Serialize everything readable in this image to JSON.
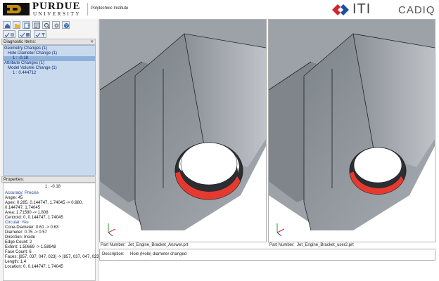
{
  "header": {
    "university": "PURDUE",
    "university_sub": "UNIVERSITY",
    "department": "Polytechnic Institute",
    "vendor": "ITI",
    "product": "CADIQ",
    "colors": {
      "purdue_gold": "#c28e0e",
      "iti_red": "#d3242e",
      "iti_blue": "#1f4e9c"
    }
  },
  "toolbar": {
    "icons": [
      "home-icon",
      "open-file-icon",
      "export-icon",
      "report-icon",
      "search-icon",
      "settings-icon",
      "help-icon",
      "check-geometry-icon",
      "check-all-icon",
      "check-filter-icon"
    ]
  },
  "diagnostics": {
    "title": "Diagnostic Items:",
    "items": [
      {
        "label": "Geometry Changes (1)",
        "level": 0
      },
      {
        "label": "Hole Diameter Change (1)",
        "level": 1
      },
      {
        "label": "1 : -0.18",
        "level": 2,
        "selected": true
      },
      {
        "label": "Attribute Changes (1)",
        "level": 0
      },
      {
        "label": "Model Volume Change (1)",
        "level": 1
      },
      {
        "label": "1 : 0.444712",
        "level": 2
      }
    ]
  },
  "properties": {
    "title": "Properties:",
    "header_value": "1 : -0.18",
    "rows": [
      {
        "text": "Accuracy: Precise",
        "blue": true
      },
      {
        "text": "Angle: 45",
        "blue": false
      },
      {
        "text": "Apex: 0.285, 0.144747, 1.74045 -> 0.980,",
        "blue": false
      },
      {
        "text": "0.144747, 1.74045",
        "blue": false
      },
      {
        "text": "Area: 1.71580 -> 1.808",
        "blue": false
      },
      {
        "text": "Centroid: 0, 0.144747, 1.74045",
        "blue": false
      },
      {
        "text": "Circular: Yes",
        "blue": true
      },
      {
        "text": "Cone-Diameter: 0.61 -> 0.63",
        "blue": false
      },
      {
        "text": "Diameter: 0.75 -> 0.57",
        "blue": false
      },
      {
        "text": "Direction: Inside",
        "blue": false
      },
      {
        "text": "Edge Count: 2",
        "blue": false
      },
      {
        "text": "Extent: 1.50669 -> 1.58948",
        "blue": false
      },
      {
        "text": "Face Count: 6",
        "blue": false
      },
      {
        "text": "Faces: [857, 037, 047, 023] -> [857, 037, 047, 023]",
        "blue": false
      },
      {
        "text": "Length: 1.4",
        "blue": false
      },
      {
        "text": "Location: 0, 0.144747, 1.74045",
        "blue": false
      }
    ]
  },
  "viewports": {
    "left_part_label": "Part Number:",
    "left_part_value": "Jet_Engine_Bracket_Answer.prt",
    "right_part_label": "Part Number:",
    "right_part_value": "Jet_Engine_Bracket_user2.prt",
    "highlight_color": "#e53a2f",
    "part_color": "#a9adb3"
  },
  "description": {
    "label": "Description:",
    "value": "Hole (Hole) diameter changed"
  }
}
